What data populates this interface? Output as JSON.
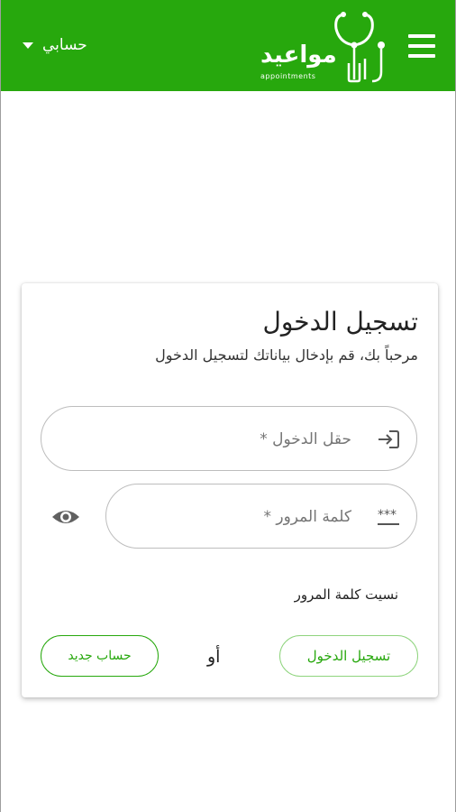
{
  "header": {
    "logo_text": "مواعيد",
    "logo_subtext": "appointments",
    "account_label": "حسابي",
    "brand_color": "#27a80d"
  },
  "login": {
    "title": "تسجيل الدخول",
    "subtitle": "مرحباً بك، قم بإدخال بياناتك لتسجيل الدخول",
    "username_placeholder": "حقل الدخول *",
    "password_placeholder": "كلمة المرور *",
    "forgot_password": "نسيت كلمة المرور",
    "login_button": "تسجيل الدخول",
    "or_text": "أو",
    "new_account_button": "حساب جديد"
  },
  "icons": {
    "menu": "hamburger-menu-icon",
    "dropdown": "caret-down-icon",
    "username": "login-icon",
    "password": "password-dots-icon",
    "toggle_password": "eye-icon"
  }
}
